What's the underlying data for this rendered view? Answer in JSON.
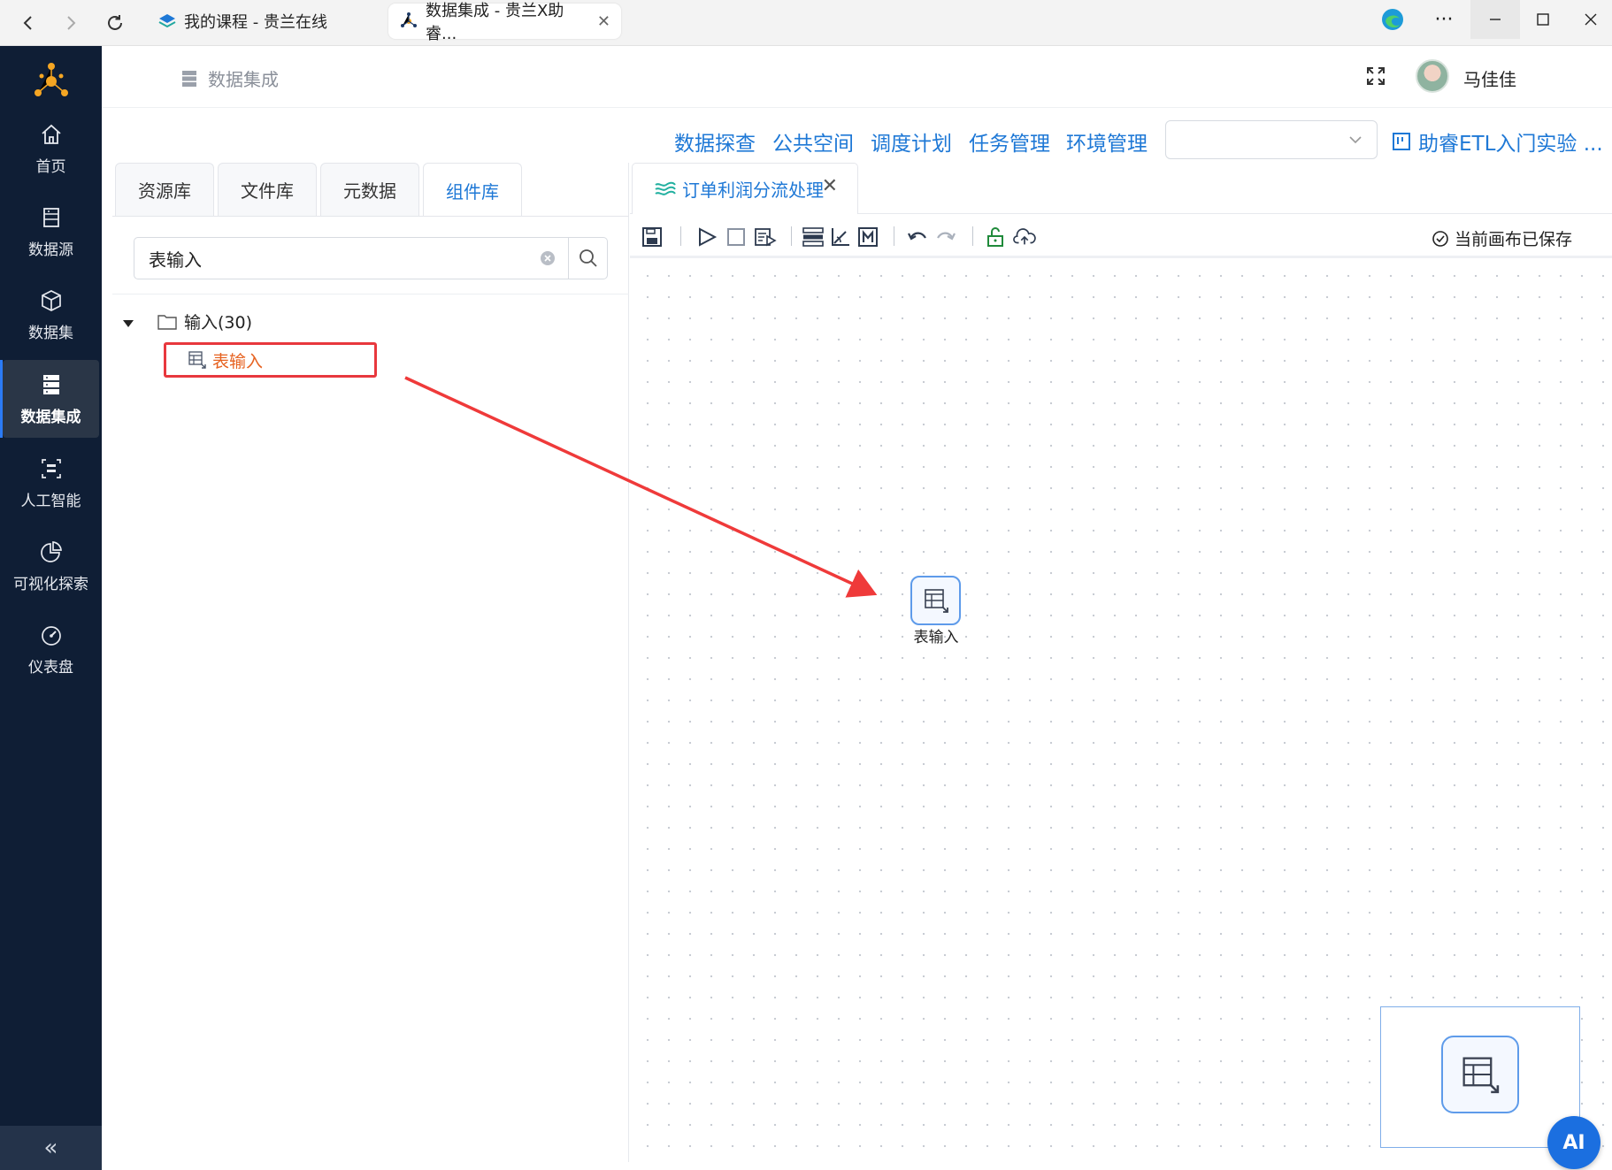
{
  "browser": {
    "tabs": [
      {
        "title": "我的课程 - 贵兰在线",
        "active": false
      },
      {
        "title": "数据集成 - 贵兰X助睿...",
        "active": true
      }
    ]
  },
  "sidebar": {
    "items": [
      {
        "label": "首页",
        "icon": "home-icon"
      },
      {
        "label": "数据源",
        "icon": "datasource-icon"
      },
      {
        "label": "数据集",
        "icon": "cube-icon"
      },
      {
        "label": "数据集成",
        "icon": "server-icon",
        "active": true
      },
      {
        "label": "人工智能",
        "icon": "ai-icon"
      },
      {
        "label": "可视化探索",
        "icon": "pie-chart-icon"
      },
      {
        "label": "仪表盘",
        "icon": "dashboard-icon"
      }
    ],
    "collapse_glyph": "«"
  },
  "header": {
    "breadcrumb": "数据集成",
    "username": "马佳佳"
  },
  "menu": {
    "links": [
      "数据探查",
      "公共空间",
      "调度计划",
      "任务管理",
      "环境管理"
    ],
    "select_value": "",
    "project": "助睿ETL入门实验 ..."
  },
  "left_panel": {
    "tabs": [
      {
        "label": "资源库",
        "active": false
      },
      {
        "label": "文件库",
        "active": false
      },
      {
        "label": "元数据",
        "active": false
      },
      {
        "label": "组件库",
        "active": true
      }
    ],
    "search_value": "表输入",
    "tree": {
      "folder": "输入(30)",
      "leaf": "表输入"
    }
  },
  "canvas": {
    "tab_title": "订单利润分流处理",
    "tab_close": "✕",
    "save_status": "当前画布已保存",
    "node_label": "表输入"
  },
  "ai_button": "AI",
  "colors": {
    "sidebar_bg": "#0f1e35",
    "accent": "#1e78d6",
    "highlight_red": "#e8383d",
    "leaf_orange": "#e6611f"
  }
}
